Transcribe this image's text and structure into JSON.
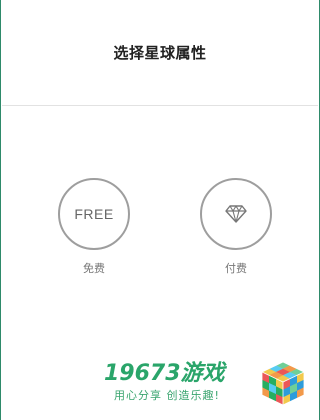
{
  "dialog": {
    "title": "选择星球属性"
  },
  "options": [
    {
      "label": "免费",
      "icon_text": "FREE",
      "icon": "free-icon"
    },
    {
      "label": "付费",
      "icon": "diamond-icon"
    }
  ],
  "watermark": {
    "brand_number": "19673",
    "brand_cn": "游戏",
    "slogan": "用心分享 创造乐趣!"
  },
  "colors": {
    "frame_border": "#2e8a6a",
    "circle_border": "#9e9e9e",
    "watermark_green": "#2aa56a"
  }
}
